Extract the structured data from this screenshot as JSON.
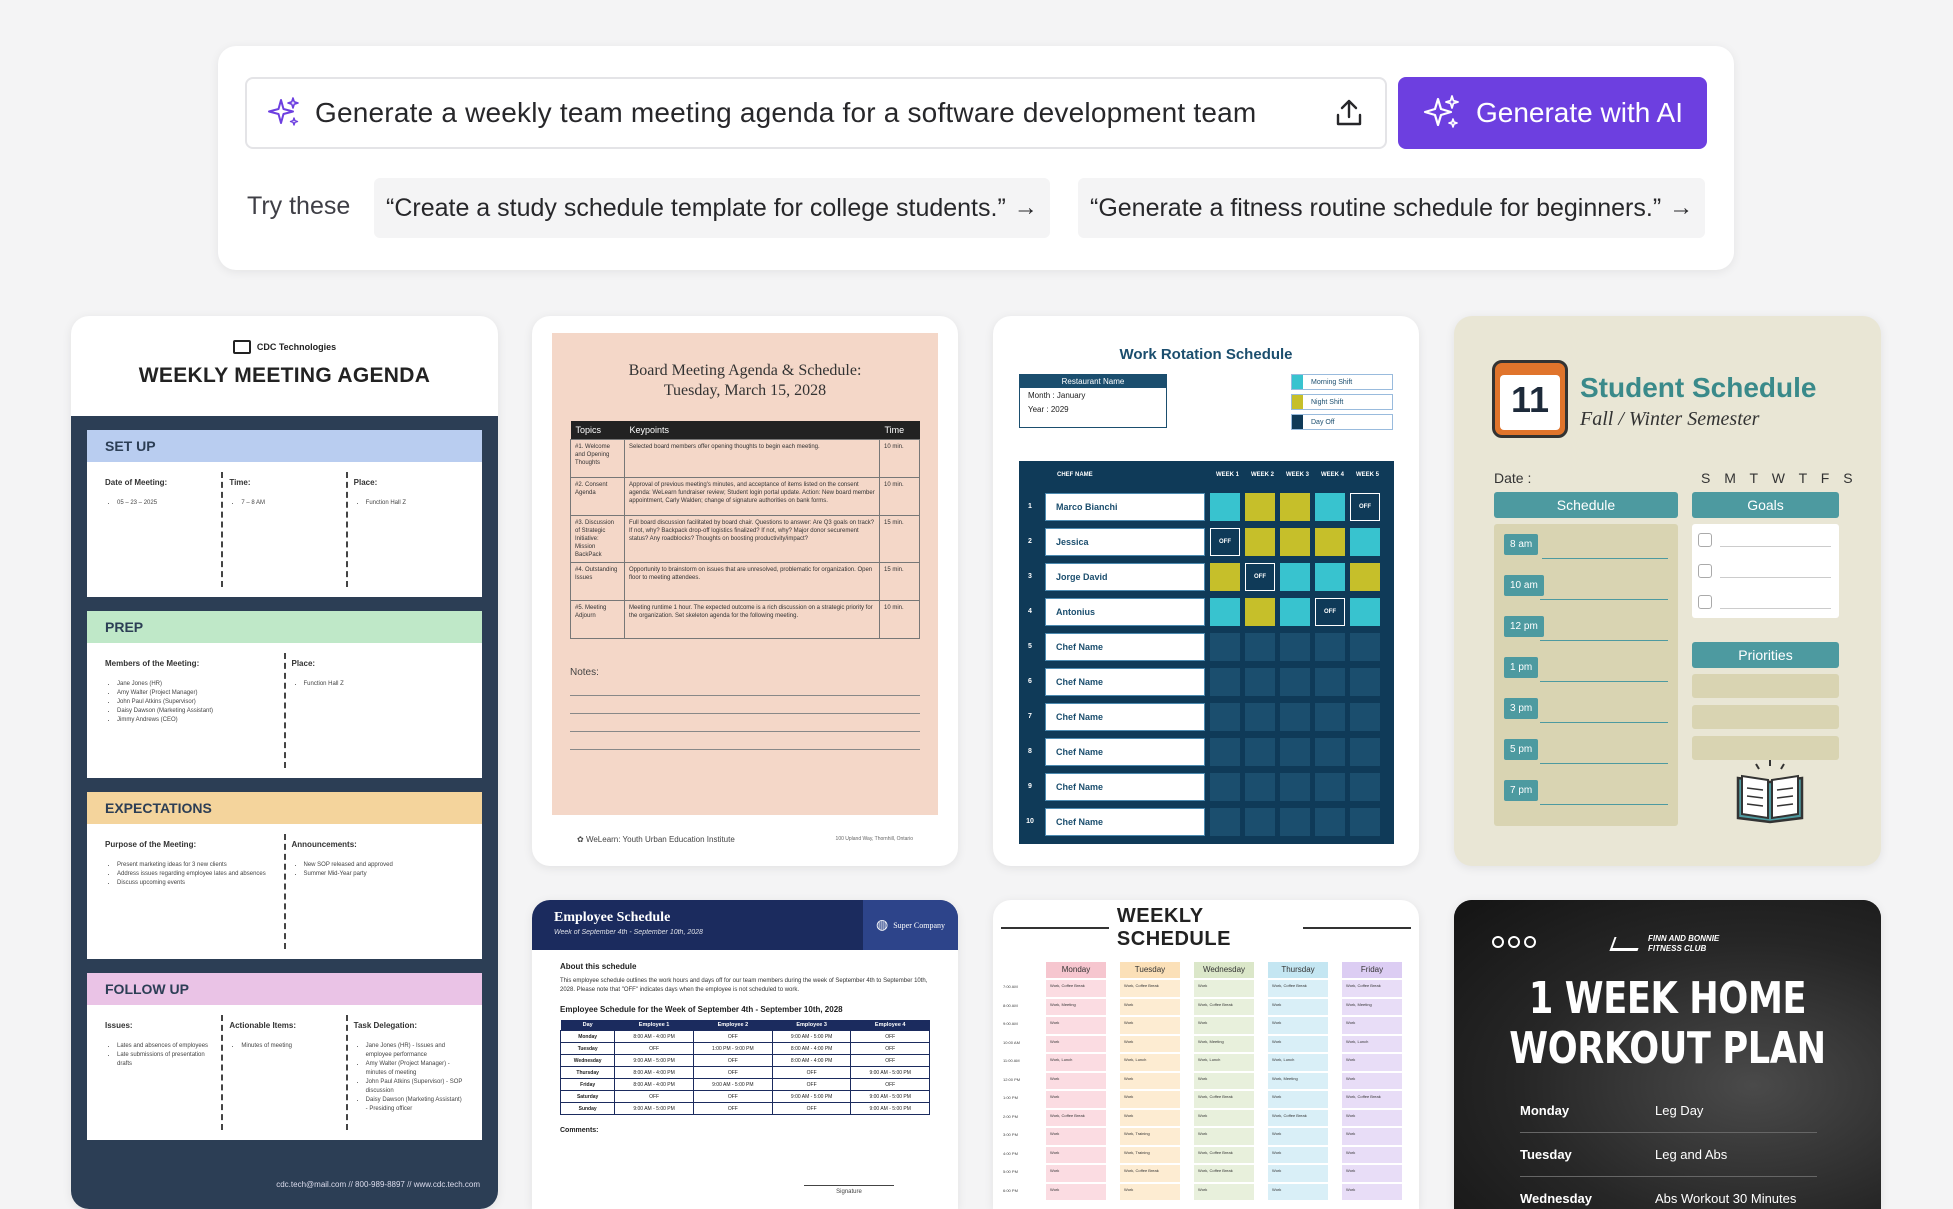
{
  "prompt": {
    "value": "Generate a weekly team meeting agenda for a software development team",
    "generate_label": "Generate with AI",
    "try_label": "Try these",
    "suggestions": [
      "“Create a study schedule template for college students.”",
      "“Generate a fitness routine schedule for beginners.”"
    ]
  },
  "colors": {
    "accent": "#6d3fe0",
    "background": "#f4f4f5"
  },
  "templates": {
    "weekly_agenda": {
      "company": "CDC Technologies",
      "title": "WEEKLY MEETING AGENDA",
      "sections": [
        {
          "name": "SET UP",
          "color": "#b9cdf0",
          "cols": [
            {
              "h": "Date of Meeting:",
              "items": [
                "05 – 23 – 2025"
              ]
            },
            {
              "h": "Time:",
              "items": [
                "7 – 8 AM"
              ]
            },
            {
              "h": "Place:",
              "items": [
                "Function Hall Z"
              ]
            }
          ]
        },
        {
          "name": "PREP",
          "color": "#bfe8c8",
          "cols": [
            {
              "h": "Members of the Meeting:",
              "items": [
                "Jane Jones (HR)",
                "Amy Walter (Project Manager)",
                "John Paul Atkins (Supervisor)",
                "Daisy Dawson (Marketing Assistant)",
                "Jimmy Andrews (CEO)"
              ]
            },
            {
              "h": "Place:",
              "items": [
                "Function Hall Z"
              ]
            }
          ]
        },
        {
          "name": "EXPECTATIONS",
          "color": "#f4d49c",
          "cols": [
            {
              "h": "Purpose of the Meeting:",
              "items": [
                "Present marketing ideas for 3 new clients",
                "Address issues regarding employee lates and absences",
                "Discuss upcoming events"
              ]
            },
            {
              "h": "Announcements:",
              "items": [
                "New SOP released and approved",
                "Summer Mid-Year party"
              ]
            }
          ]
        },
        {
          "name": "FOLLOW UP",
          "color": "#eac3e6",
          "cols": [
            {
              "h": "Issues:",
              "items": [
                "Lates and absences of employees",
                "Late submissions of presentation drafts"
              ]
            },
            {
              "h": "Actionable Items:",
              "items": [
                "Minutes of meeting"
              ]
            },
            {
              "h": "Task Delegation:",
              "items": [
                "Jane Jones (HR) - Issues and employee performance",
                "Amy Walter (Project Manager) - minutes of meeting",
                "John Paul Atkins (Supervisor) - SOP discussion",
                "Daisy Dawson (Marketing Assistant) - Presiding officer"
              ]
            }
          ]
        }
      ],
      "footer": "cdc.tech@mail.com // 800-989-8897 // www.cdc.tech.com"
    },
    "board_meeting": {
      "title": "Board Meeting Agenda & Schedule:",
      "date": "Tuesday, March 15, 2028",
      "headers": [
        "Topics",
        "Keypoints",
        "Time"
      ],
      "rows": [
        [
          "#1. Welcome and Opening Thoughts",
          "Selected board members offer opening thoughts to begin each meeting.",
          "10 min."
        ],
        [
          "#2. Consent Agenda",
          "Approval of previous meeting's minutes, and acceptance of items listed on the consent agenda: WeLearn fundraiser review; Student login portal update. Action: New board member appointment, Carly Walden; change of signature authorities on bank forms.",
          "10 min."
        ],
        [
          "#3. Discussion of Strategic Initiative: Mission BackPack",
          "Full board discussion facilitated by board chair. Questions to answer: Are Q3 goals on track? If not, why? Backpack drop-off logistics finalized? If not, why? Major donor securement status? Any roadblocks? Thoughts on boosting productivity/impact?",
          "15 min."
        ],
        [
          "#4. Outstanding Issues",
          "Opportunity to brainstorm on issues that are unresolved, problematic for organization. Open floor to meeting attendees.",
          "15 min."
        ],
        [
          "#5. Meeting Adjourn",
          "Meeting runtime 1 hour. The expected outcome is a rich discussion on a strategic priority for the organization. Set skeleton agenda for the following meeting.",
          "10 min."
        ]
      ],
      "notes_label": "Notes:",
      "org": "WeLearn: Youth Urban Education Institute",
      "address": "100 Upland Way, Thornhill, Ontario"
    },
    "work_rotation": {
      "title": "Work Rotation Schedule",
      "restaurant": "Restaurant Name",
      "month": "Month    :  January",
      "year": "Year       :  2029",
      "legend": [
        {
          "label": "Morning Shift",
          "color": "#38c3cf"
        },
        {
          "label": "Night Shift",
          "color": "#c6bf2a"
        },
        {
          "label": "Day Off",
          "color": "#0f3a58"
        }
      ],
      "col_headers": [
        "CHEF NAME",
        "WEEK 1",
        "WEEK 2",
        "WEEK 3",
        "WEEK 4",
        "WEEK 5"
      ],
      "off_label": "OFF",
      "rows": [
        {
          "n": "1",
          "name": "Marco Bianchi",
          "cells": [
            "cy",
            "ye",
            "ye",
            "cy",
            "of"
          ]
        },
        {
          "n": "2",
          "name": "Jessica",
          "cells": [
            "of",
            "ye",
            "ye",
            "ye",
            "cy"
          ]
        },
        {
          "n": "3",
          "name": "Jorge David",
          "cells": [
            "ye",
            "of",
            "cy",
            "cy",
            "ye"
          ]
        },
        {
          "n": "4",
          "name": "Antonius",
          "cells": [
            "cy",
            "ye",
            "cy",
            "of",
            "cy"
          ]
        },
        {
          "n": "5",
          "name": "Chef Name",
          "cells": [
            "",
            "",
            "",
            "",
            ""
          ]
        },
        {
          "n": "6",
          "name": "Chef Name",
          "cells": [
            "",
            "",
            "",
            "",
            ""
          ]
        },
        {
          "n": "7",
          "name": "Chef Name",
          "cells": [
            "",
            "",
            "",
            "",
            ""
          ]
        },
        {
          "n": "8",
          "name": "Chef Name",
          "cells": [
            "",
            "",
            "",
            "",
            ""
          ]
        },
        {
          "n": "9",
          "name": "Chef Name",
          "cells": [
            "",
            "",
            "",
            "",
            ""
          ]
        },
        {
          "n": "10",
          "name": "Chef Name",
          "cells": [
            "",
            "",
            "",
            "",
            ""
          ]
        }
      ]
    },
    "student_schedule": {
      "icon_number": "11",
      "title": "Student Schedule",
      "subtitle": "Fall / Winter Semester",
      "date_label": "Date :",
      "days": "S M T W T F S",
      "schedule_label": "Schedule",
      "goals_label": "Goals",
      "priorities_label": "Priorities",
      "times": [
        "8 am",
        "10 am",
        "12 pm",
        "1 pm",
        "3 pm",
        "5 pm",
        "7 pm"
      ]
    },
    "employee_schedule": {
      "title": "Employee Schedule",
      "subtitle": "Week of September 4th - September 10th, 2028",
      "company": "Super Company",
      "about_label": "About this schedule",
      "about_text": "This employee schedule outlines the work hours and days off for our team members during the week of September 4th to September 10th, 2028. Please note that \"OFF\" indicates days when the employee is not scheduled to work.",
      "table_label": "Employee Schedule for the Week of September 4th - September 10th, 2028",
      "headers": [
        "Day",
        "Employee 1",
        "Employee 2",
        "Employee 3",
        "Employee 4"
      ],
      "rows": [
        [
          "Monday",
          "8:00 AM - 4:00 PM",
          "OFF",
          "9:00 AM - 5:00 PM",
          "OFF"
        ],
        [
          "Tuesday",
          "OFF",
          "1:00 PM - 9:00 PM",
          "8:00 AM - 4:00 PM",
          "OFF"
        ],
        [
          "Wednesday",
          "9:00 AM - 5:00 PM",
          "OFF",
          "8:00 AM - 4:00 PM",
          "OFF"
        ],
        [
          "Thursday",
          "8:00 AM - 4:00 PM",
          "OFF",
          "OFF",
          "9:00 AM - 5:00 PM"
        ],
        [
          "Friday",
          "8:00 AM - 4:00 PM",
          "9:00 AM - 5:00 PM",
          "OFF",
          "OFF"
        ],
        [
          "Saturday",
          "OFF",
          "OFF",
          "9:00 AM - 5:00 PM",
          "9:00 AM - 5:00 PM"
        ],
        [
          "Sunday",
          "9:00 AM - 5:00 PM",
          "OFF",
          "OFF",
          "9:00 AM - 5:00 PM"
        ]
      ],
      "comments_label": "Comments:",
      "signature_label": "Signature"
    },
    "weekly_schedule": {
      "title": "WEEKLY SCHEDULE",
      "days": [
        {
          "name": "Monday",
          "color": "#f6c6cf",
          "light": "#fbdce2",
          "items": [
            "Work, Coffee Break",
            "Work, Meeting",
            "Work",
            "Work",
            "Work, Lunch",
            "Work",
            "Work",
            "Work, Coffee Break",
            "Work",
            "Work",
            "Work",
            "Work"
          ]
        },
        {
          "name": "Tuesday",
          "color": "#fbe0b8",
          "light": "#fdecd2",
          "items": [
            "Work, Coffee Break",
            "Work",
            "Work",
            "Work",
            "Work, Lunch",
            "Work",
            "Work",
            "Work",
            "Work, Training",
            "Work, Training",
            "Work, Coffee Break",
            "Work"
          ]
        },
        {
          "name": "Wednesday",
          "color": "#dbe7c9",
          "light": "#e8f0dc",
          "items": [
            "Work",
            "Work, Coffee Break",
            "Work",
            "Work, Meeting",
            "Work, Lunch",
            "Work",
            "Work, Coffee Break",
            "Work",
            "Work",
            "Work, Coffee Break",
            "Work, Coffee Break",
            "Work"
          ]
        },
        {
          "name": "Thursday",
          "color": "#c4e6f2",
          "light": "#d9eff7",
          "items": [
            "Work, Coffee Break",
            "Work",
            "Work",
            "Work",
            "Work, Lunch",
            "Work, Meeting",
            "Work",
            "Work, Coffee Break",
            "Work",
            "Work",
            "Work",
            "Work"
          ]
        },
        {
          "name": "Friday",
          "color": "#dccdf3",
          "light": "#e8ddf7",
          "items": [
            "Work, Coffee Break",
            "Work, Meeting",
            "Work",
            "Work, Lunch",
            "Work",
            "Work",
            "Work, Coffee Break",
            "Work",
            "Work",
            "Work",
            "Work",
            "Work"
          ]
        }
      ],
      "times": [
        "7:00 AM",
        "8:00 AM",
        "9:00 AM",
        "10:00 AM",
        "11:00 AM",
        "12:00 PM",
        "1:00 PM",
        "2:00 PM",
        "3:00 PM",
        "4:00 PM",
        "5:00 PM",
        "6:00 PM"
      ]
    },
    "workout_plan": {
      "club": "FINN AND BONNIE\nFITNESS CLUB",
      "title_line1": "1 WEEK HOME",
      "title_line2": "WORKOUT PLAN",
      "rows": [
        {
          "day": "Monday",
          "workout": "Leg Day"
        },
        {
          "day": "Tuesday",
          "workout": "Leg and Abs"
        },
        {
          "day": "Wednesday",
          "workout": "Abs Workout 30 Minutes"
        }
      ]
    }
  }
}
